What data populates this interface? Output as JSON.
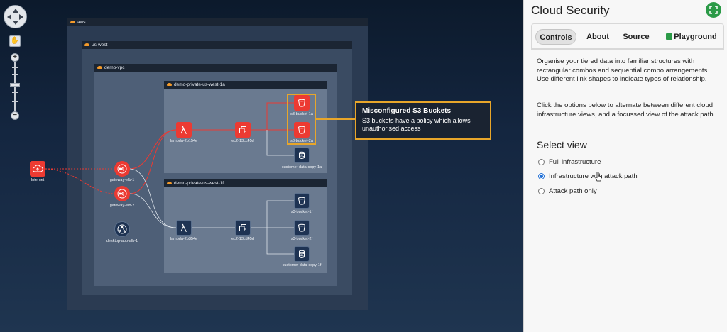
{
  "graph": {
    "combos": {
      "aws": "aws",
      "region": "us-west",
      "vpc": "demo-vpc",
      "subnet_a": "demo-private-us-west-1a",
      "subnet_f": "demo-private-us-west-1f"
    },
    "nodes": {
      "internet": "Internet",
      "gateway1": "gateway-elb-1",
      "gateway2": "gateway-elb-2",
      "desktop": "desktop-app-alb-1",
      "lambda_a": "lambda-2b154e",
      "ec2_a": "ec2-13cc45d",
      "s3_1a": "s3-bucket-1a",
      "s3_2a": "s3-bucket-2a",
      "db_1a": "customer data-copy-1a",
      "lambda_f": "lambda-2b354e",
      "ec2_f": "ec2-13cd45d",
      "s3_1f": "s3-bucket-1f",
      "s3_2f": "s3-bucket-2f",
      "db_1f": "customer data-copy-1f"
    },
    "tooltip": {
      "title": "Misconfigured S3 Buckets",
      "body": "S3 buckets have a policy which allows unauthorised access"
    },
    "colors": {
      "attack": "#ec3a32",
      "highlight": "#e8a62a",
      "normal_edge": "#dfe5ec"
    }
  },
  "navigation": {
    "zoom_in": "+",
    "zoom_out": "−",
    "hand": "✋"
  },
  "panel": {
    "title": "Cloud Security",
    "tabs": {
      "controls": "Controls",
      "about": "About",
      "source": "Source",
      "playground": "Playground"
    },
    "intro": "Organise your tiered data into familiar structures with rectangular combos and sequential combo arrangements. Use different link shapes to indicate types of relationship.",
    "instructions": "Click the options below to alternate between different cloud infrastructure views, and a focussed view of the attack path.",
    "select_heading": "Select view",
    "options": {
      "full": "Full infrastructure",
      "attack": "Infrastructure with attack path",
      "only": "Attack path only"
    },
    "selected_option": "Infrastructure with attack path"
  }
}
